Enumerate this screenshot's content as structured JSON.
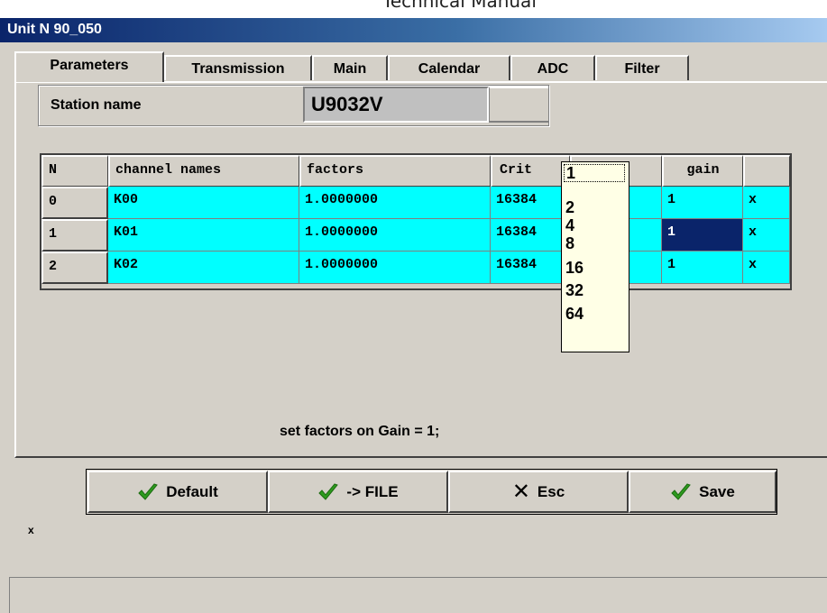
{
  "doc_header": "Technical Manual",
  "window": {
    "title": "Unit  N 90_050"
  },
  "tabs": [
    {
      "label": "Parameters"
    },
    {
      "label": "Transmission"
    },
    {
      "label": "Main"
    },
    {
      "label": "Calendar"
    },
    {
      "label": "ADC"
    },
    {
      "label": "Filter"
    }
  ],
  "station": {
    "label": "Station name",
    "value": "U9032V"
  },
  "table": {
    "headers": [
      "N",
      "channel names",
      "factors",
      "Crit",
      "",
      "gain",
      ""
    ],
    "rows": [
      {
        "n": "0",
        "name": "K00",
        "factor": "1.0000000",
        "crit": "16384",
        "gain": "1",
        "flag": "x"
      },
      {
        "n": "1",
        "name": "K01",
        "factor": "1.0000000",
        "crit": "16384",
        "gain": "1",
        "flag": "x"
      },
      {
        "n": "2",
        "name": "K02",
        "factor": "1.0000000",
        "crit": "16384",
        "gain": "1",
        "flag": "x"
      }
    ],
    "selected_row": 1
  },
  "gain_dropdown": {
    "options": [
      "1",
      "2",
      "4",
      "8",
      "16",
      "32",
      "64"
    ],
    "selected": "1"
  },
  "message": "set factors on Gain = 1;",
  "buttons": {
    "default": "Default",
    "to_file": "-> FILE",
    "esc": "Esc",
    "save": "Save"
  },
  "small_mark": "x",
  "colors": {
    "row_bg": "#00ffff",
    "selection": "#0a246a",
    "window_bg": "#d4d0c8",
    "titlebar": "#0a246a",
    "check": "#2e9b1f"
  }
}
